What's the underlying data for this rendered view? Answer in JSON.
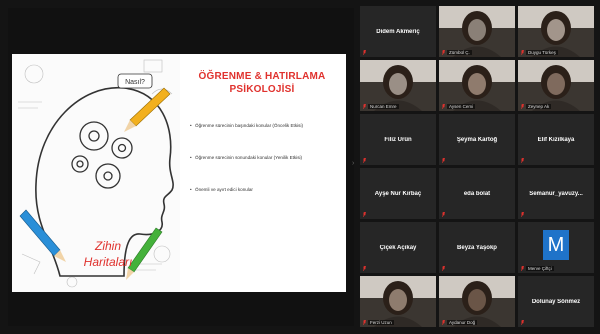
{
  "slide": {
    "title_line1": "ÖĞRENME & HATIRLAMA",
    "title_line2": "PSİKOLOJİSİ",
    "bullets": [
      "Öğrenme sürecinin başındaki konular (Öncelik Etkisi)",
      "Öğrenme sürecinin sonundaki konular (Yenilik Etkisi)",
      "Önemli ve ayırt edici konular"
    ],
    "illustration_text_line1": "Zihin",
    "illustration_text_line2": "Haritaları",
    "illustration_tag": "Nasıl?"
  },
  "participants": [
    {
      "name": "Didem Akmeriç",
      "mic": "muted",
      "video": false
    },
    {
      "name": "Zümbül Ç.",
      "mic": "muted",
      "video": true,
      "tone": "#8a8077"
    },
    {
      "name": "Duygu Türkeş",
      "mic": "muted",
      "video": true,
      "tone": "#a2958b"
    },
    {
      "name": "Nurcan Emre",
      "mic": "muted",
      "video": true,
      "tone": "#9a8f86"
    },
    {
      "name": "Aysen Cemi",
      "mic": "muted",
      "video": true,
      "tone": "#8f7b6d"
    },
    {
      "name": "Zeynep Ak",
      "mic": "muted",
      "video": true,
      "tone": "#7f6a5d"
    },
    {
      "name": "Filiz Ürün",
      "mic": "muted",
      "video": false
    },
    {
      "name": "Şeyma Kartoğ",
      "mic": "muted",
      "video": false
    },
    {
      "name": "Elif Kızılkaya",
      "mic": "muted",
      "video": false
    },
    {
      "name": "Ayşe Nur Kırbaç",
      "mic": "muted",
      "video": false
    },
    {
      "name": "eda bolat",
      "mic": "muted",
      "video": false
    },
    {
      "name": "Semanur_yavuzy...",
      "mic": "muted",
      "video": false
    },
    {
      "name": "Çiçek Açıkay",
      "mic": "muted",
      "video": false
    },
    {
      "name": "Beyza Yaşokp",
      "mic": "muted",
      "video": false
    },
    {
      "name": "Merve Çiftçi",
      "mic": "muted",
      "video": false,
      "avatar_letter": "M"
    },
    {
      "name": "Ferzi Uzun",
      "mic": "muted",
      "video": true,
      "tone": "#8e7c6e"
    },
    {
      "name": "Aydanur Doğ",
      "mic": "muted",
      "video": true,
      "tone": "#6a5547"
    },
    {
      "name": "Dolunay Sönmez",
      "mic": "muted",
      "video": false
    }
  ],
  "colors": {
    "title_red": "#e0322e",
    "mic_muted": "#e0322e",
    "tile_bg": "#262626",
    "avatar_blue": "#1f73c9"
  }
}
